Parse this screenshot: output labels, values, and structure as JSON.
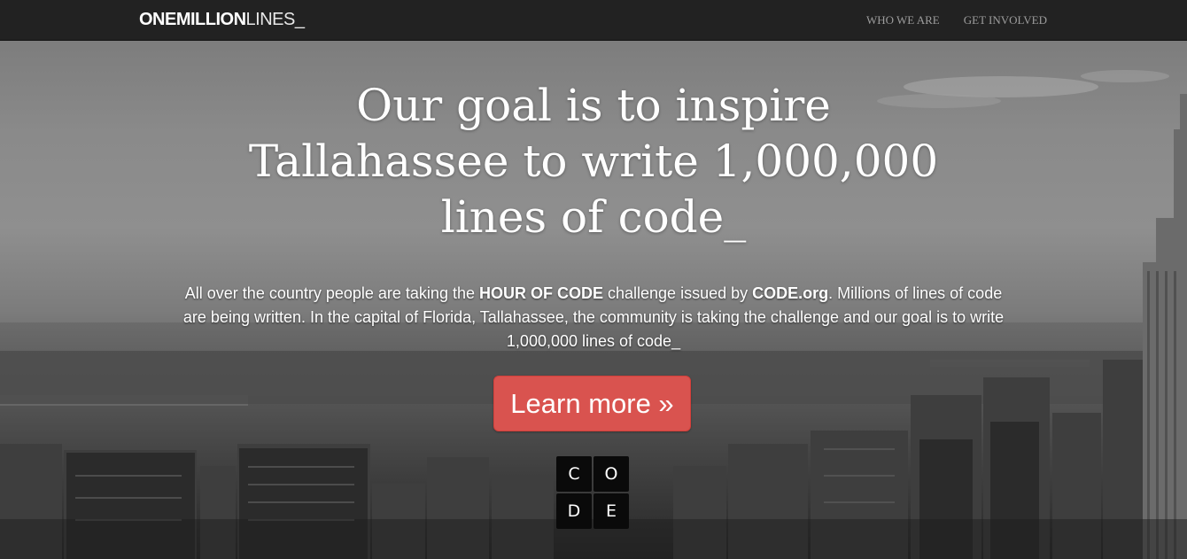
{
  "navbar": {
    "brand_bold": "ONEMILLION",
    "brand_light": "LINES_",
    "links": [
      {
        "label": "WHO WE ARE"
      },
      {
        "label": "GET INVOLVED"
      }
    ]
  },
  "hero": {
    "headline_line1": "Our goal is to inspire",
    "headline_line2": "Tallahassee to write 1,000,000",
    "headline_line3": "lines of code_",
    "lead_part1": "All over the country people are taking the ",
    "lead_bold1": "HOUR OF CODE",
    "lead_part2": " challenge issued by ",
    "lead_bold2": "CODE.org",
    "lead_part3": ". Millions of lines of code are being written. In the capital of Florida, Tallahassee, the community is taking the challenge and our goal is to write 1,000,000 lines of code_",
    "button_label": "Learn more »",
    "button_color": "#d9534f",
    "code_logo_letters": [
      "C",
      "O",
      "D",
      "E"
    ]
  }
}
